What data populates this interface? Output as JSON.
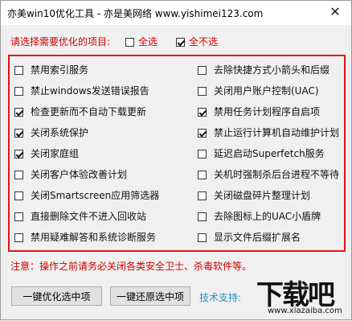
{
  "title": "亦美win10优化工具 - 亦是美网络 www.yishimei123.com",
  "close_glyph": "✕",
  "select_prompt": "请选择需要优化的项目:",
  "select_all": {
    "label": "全选",
    "checked": false
  },
  "select_none": {
    "label": "全不选",
    "checked": true
  },
  "options_left": [
    {
      "label": "禁用索引服务",
      "checked": false
    },
    {
      "label": "禁止windows发送错误报告",
      "checked": false
    },
    {
      "label": "检查更新而不自动下载更新",
      "checked": true
    },
    {
      "label": "关闭系统保护",
      "checked": true
    },
    {
      "label": "关闭家庭组",
      "checked": true
    },
    {
      "label": "关闭客户体验改善计划",
      "checked": false
    },
    {
      "label": "关闭Smartscreen应用筛选器",
      "checked": false
    },
    {
      "label": "直接删除文件不进入回收站",
      "checked": false
    },
    {
      "label": "禁用疑难解答和系统诊断服务",
      "checked": false
    }
  ],
  "options_right": [
    {
      "label": "去除快捷方式小箭头和后缀",
      "checked": false
    },
    {
      "label": "关闭用户账户控制(UAC)",
      "checked": false
    },
    {
      "label": "禁用任务计划程序自启项",
      "checked": true
    },
    {
      "label": "禁止运行计算机自动维护计划",
      "checked": true
    },
    {
      "label": "延迟启动Superfetch服务",
      "checked": false
    },
    {
      "label": "关机时强制杀后台进程不等待",
      "checked": false
    },
    {
      "label": "关闭磁盘碎片整理计划",
      "checked": false
    },
    {
      "label": "去除图标上的UAC小盾牌",
      "checked": false
    },
    {
      "label": "显示文件后缀扩展名",
      "checked": false
    }
  ],
  "note": "注意：操作之前请务必关闭各类安全卫士、杀毒软件等。",
  "buttons": {
    "optimize": "一键优化选中项",
    "restore": "一键还原选中项"
  },
  "support": "技术支持:",
  "watermark": {
    "main": "下载吧",
    "url": "www.xiazaiba.com"
  }
}
